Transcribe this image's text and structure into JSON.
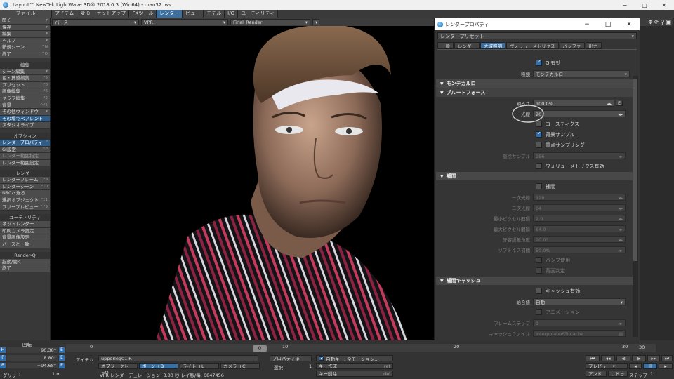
{
  "window": {
    "title": "Layout™ NewTek LightWave 3D® 2018.0.3 (Win64) - man32.lws",
    "min": "−",
    "max": "□",
    "close": "✕"
  },
  "menubar": {
    "left_label": "ファイル",
    "tabs": [
      "アイテム",
      "変形",
      "セットアップ",
      "FXツール",
      "レンダー",
      "ビュー",
      "モデル",
      "I/O",
      "ユーティリティ"
    ],
    "active": "レンダー"
  },
  "sidebar": {
    "items_a": [
      {
        "label": "開く",
        "key": "▾"
      },
      {
        "label": "保存",
        "key": "▾"
      },
      {
        "label": "編集",
        "key": "▾"
      },
      {
        "label": "ヘルプ",
        "key": "▾"
      },
      {
        "label": "新規シーン",
        "key": "^N"
      },
      {
        "label": "終了",
        "key": "^Q"
      }
    ],
    "head_edit": "編集",
    "items_b": [
      {
        "label": "シーン編集",
        "key": "▾"
      },
      {
        "label": "色・質感編集",
        "key": "F5"
      },
      {
        "label": "プリセット",
        "key": "F8"
      },
      {
        "label": "画像編集",
        "key": "F6"
      },
      {
        "label": "グラフ編集",
        "key": "F2"
      },
      {
        "label": "背景",
        "key": "^F5"
      },
      {
        "label": "その他ウィンドウ",
        "key": "▾"
      },
      {
        "label": "その場でペアレント",
        "key": ""
      },
      {
        "label": "スタジオライブ",
        "key": ""
      }
    ],
    "head_option": "オプション",
    "items_c": [
      {
        "label": "レンダープロパティ",
        "key": "F"
      },
      {
        "label": "GI設定",
        "key": "^P"
      },
      {
        "label": "レンダー範囲指定",
        "key": ""
      },
      {
        "label": "レンダー範囲設定",
        "key": ""
      }
    ],
    "head_render": "レンダー",
    "items_d": [
      {
        "label": "レンダーフレーム",
        "key": "F9"
      },
      {
        "label": "レンダーシーン",
        "key": "F10"
      },
      {
        "label": "NRCへ送る",
        "key": ""
      },
      {
        "label": "選択オブジェクト",
        "key": "F11"
      },
      {
        "label": "フリープレビュー",
        "key": "^F9"
      }
    ],
    "head_util": "ユーティリティ",
    "items_e": [
      {
        "label": "ネットレンダー",
        "key": ""
      },
      {
        "label": "印刷カメラ設定",
        "key": ""
      },
      {
        "label": "背景画像設定",
        "key": ""
      },
      {
        "label": "パースと一致",
        "key": ""
      }
    ],
    "head_rq": "Render-Q",
    "items_f": [
      {
        "label": "起動/開く",
        "key": ""
      },
      {
        "label": "終了",
        "key": ""
      }
    ]
  },
  "viewport": {
    "view": "パース",
    "mode": "VPR",
    "camera": "Final_Render",
    "icons": [
      "move-icon",
      "rotate-icon",
      "zoom-icon",
      "maximize-icon"
    ]
  },
  "dialog": {
    "title": "レンダープロパティ",
    "preset": "レンダープリセット",
    "tabs": [
      "一般",
      "レンダー",
      "大域照明",
      "ヴォリューメトリクス",
      "バッファ",
      "出力"
    ],
    "active_tab": "大域照明",
    "gi_enabled": "GI有効",
    "type_label": "種類",
    "type_value": "モンテカルロ",
    "sec_monte": "モンテカルロ",
    "sec_brute": "ブルートフォース",
    "brightness_label": "明るさ",
    "brightness_value": "100.0%",
    "brightness_btn": "E",
    "rays_label": "光線",
    "rays_value": "20",
    "caustics": "コースティクス",
    "bg_sample": "背景サンプル",
    "imp_sample": "重点サンプリング",
    "imp_sample_label": "重点サンプル",
    "imp_sample_value": "256",
    "vol_enable": "ヴォリューメトリクス有効",
    "sec_interp": "補間",
    "interp": "補間",
    "interp_rows": [
      {
        "label": "一次光線",
        "value": "128"
      },
      {
        "label": "二次光線",
        "value": "64"
      },
      {
        "label": "最小ピクセル間隔",
        "value": "2.0"
      },
      {
        "label": "最大ピクセル間隔",
        "value": "64.0"
      },
      {
        "label": "許容誤差角度",
        "value": "20.0°"
      },
      {
        "label": "ソフトネス補間",
        "value": "50.0%"
      }
    ],
    "bump": "バンプ使用",
    "behind": "背面判定",
    "sec_cache": "補間キャッシュ",
    "cache_enable": "キャッシュ有効",
    "mode_label": "給合値",
    "mode_value": "自動",
    "anim": "アニメーション",
    "frame_step_label": "フレームステップ",
    "frame_step_value": "1",
    "cache_file_label": "キャッシュファイル",
    "cache_file_value": "InterpolatedGI.cache"
  },
  "timeline": {
    "ticks": [
      "0",
      "10",
      "20",
      "30"
    ],
    "current": "0",
    "end": "30"
  },
  "bottom": {
    "rotate_label": "回転",
    "h": {
      "letter": "H",
      "value": "90.38°"
    },
    "p": {
      "letter": "P",
      "value": "8.80°"
    },
    "b": {
      "letter": "B",
      "value": "−94.68°"
    },
    "grid_label": "グリッド",
    "grid_value": "1 m",
    "item_label": "アイテム",
    "item_value": "upperleg01.R",
    "obj": "オブジェクト",
    "obj_k": "+O",
    "bone": "ボーン",
    "bone_k": "+B",
    "light": "ライト",
    "light_k": "+L",
    "camera": "カメラ",
    "camera_k": "+C",
    "props": "プロパティ",
    "props_k": "p",
    "select_label": "選択",
    "select_value": "1",
    "vpr_status": "VPR レンダーデュレーション: 3.80 秒 レイ秒/毎: 6847456",
    "autokey": "自動キー: 全モーション…",
    "key_create": "キー作成",
    "key_create_k": "ret",
    "key_delete": "キー削除",
    "key_delete_k": "del",
    "preview": "プレビュー",
    "undo": "アンドゥ",
    "redo": "リドゥ",
    "step_label": "ステップ",
    "step_value": "1"
  }
}
